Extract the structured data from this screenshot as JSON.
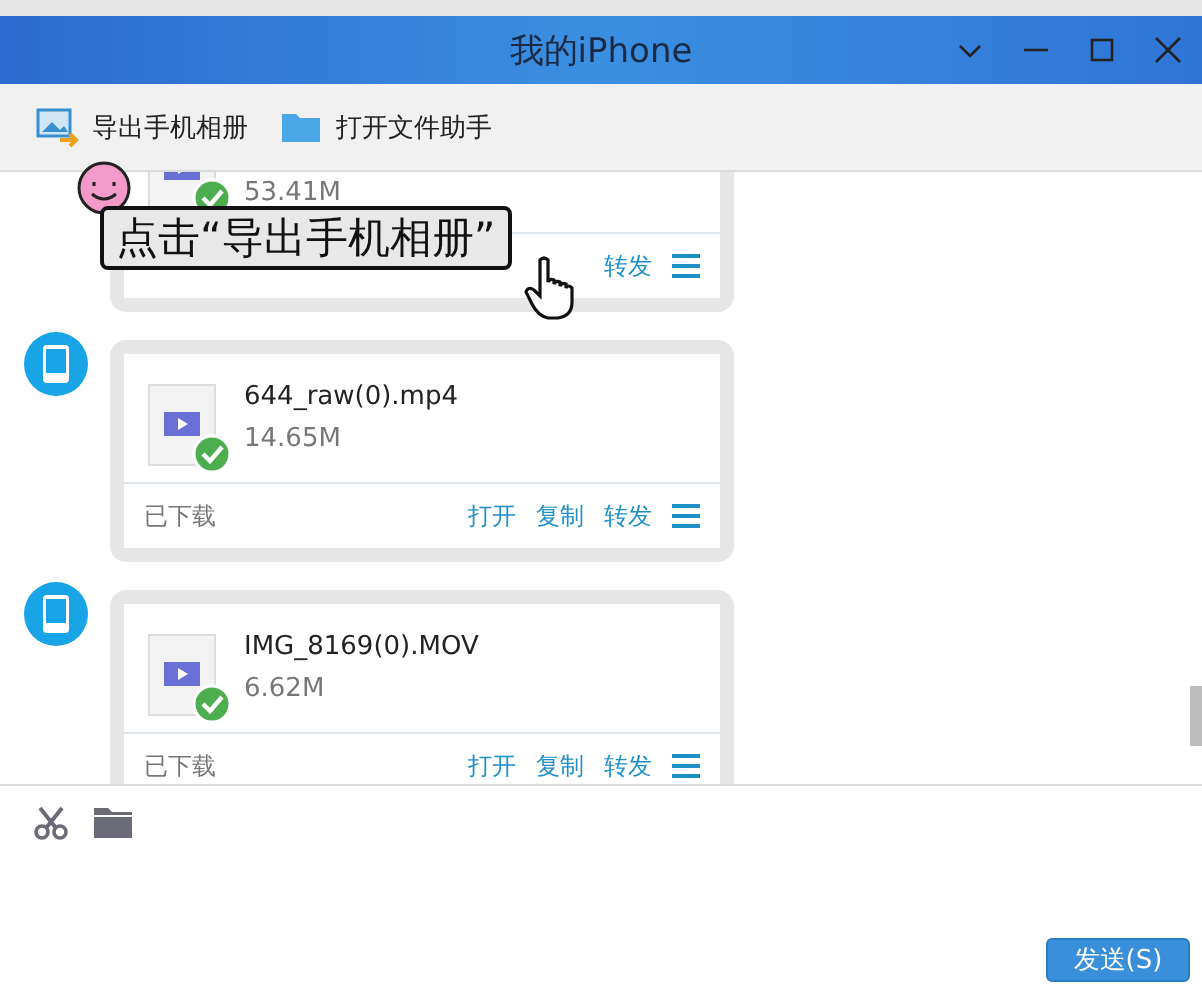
{
  "window": {
    "title": "我的iPhone"
  },
  "toolbar": [
    {
      "label": "导出手机相册"
    },
    {
      "label": "打开文件助手"
    }
  ],
  "messages": [
    {
      "size": "53.41M",
      "downloaded": true,
      "actions": [
        "转发"
      ]
    },
    {
      "file_name": "644_raw(0).mp4",
      "size": "14.65M",
      "status": "已下载",
      "downloaded": true,
      "actions": [
        "打开",
        "复制",
        "转发"
      ]
    },
    {
      "file_name": "IMG_8169(0).MOV",
      "size": "6.62M",
      "status": "已下载",
      "downloaded": true,
      "actions": [
        "打开",
        "复制",
        "转发"
      ]
    }
  ],
  "hint": {
    "text": "点击“导出手机相册”"
  },
  "send_button": {
    "label": "发送(S)"
  }
}
